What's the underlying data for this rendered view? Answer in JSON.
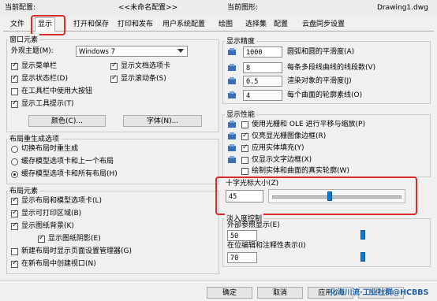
{
  "header": {
    "current_profile_label": "当前配置:",
    "current_profile_value": "<<未命名配置>>",
    "current_drawing_label": "当前图形:",
    "current_drawing_value": "Drawing1.dwg"
  },
  "tabs": [
    {
      "label": "文件"
    },
    {
      "label": "显示"
    },
    {
      "label": "打开和保存"
    },
    {
      "label": "打印和发布"
    },
    {
      "label": "用户系统配置"
    },
    {
      "label": "绘图"
    },
    {
      "label": "选择集"
    },
    {
      "label": "配置"
    },
    {
      "label": "云盘同步设置"
    }
  ],
  "window_elements": {
    "title": "窗口元素",
    "theme_label": "外观主题(M):",
    "theme_value": "Windows 7",
    "checks": [
      {
        "label": "显示菜单栏",
        "checked": true
      },
      {
        "label": "显示文档选项卡",
        "checked": true
      },
      {
        "label": "显示状态栏(D)",
        "checked": true
      },
      {
        "label": "显示滚动条(S)",
        "checked": true
      },
      {
        "label": "在工具栏中使用大按钮",
        "checked": false
      },
      {
        "label": "显示工具提示(T)",
        "checked": true
      }
    ],
    "color_button": "颜色(C)...",
    "font_button": "字体(N)..."
  },
  "layout_regen": {
    "title": "布局重生成选项",
    "options": [
      {
        "label": "切换布局时重生成",
        "selected": false
      },
      {
        "label": "缓存模型选项卡和上一个布局",
        "selected": false
      },
      {
        "label": "缓存模型选项卡和所有布局(H)",
        "selected": true
      }
    ]
  },
  "layout_elements": {
    "title": "布局元素",
    "checks": [
      {
        "label": "显示布局和模型选项卡(L)",
        "checked": true
      },
      {
        "label": "显示可打印区域(B)",
        "checked": true
      },
      {
        "label": "显示图纸背景(K)",
        "checked": true
      },
      {
        "label": "显示图纸阴影(E)",
        "checked": true
      },
      {
        "label": "新建布局时显示页面设置管理器(G)",
        "checked": false
      },
      {
        "label": "在新布局中创建视口(N)",
        "checked": true
      }
    ]
  },
  "display_resolution": {
    "title": "显示精度",
    "rows": [
      {
        "value": "1000",
        "label": "圆弧和圆的平滑度(A)"
      },
      {
        "value": "8",
        "label": "每条多段线曲线的线段数(V)"
      },
      {
        "value": "0.5",
        "label": "渲染对象的平滑度(J)"
      },
      {
        "value": "4",
        "label": "每个曲面的轮廓素线(O)"
      }
    ]
  },
  "display_performance": {
    "title": "显示性能",
    "checks": [
      {
        "label": "使用光栅和 OLE 进行平移与缩放(P)",
        "checked": false
      },
      {
        "label": "仅亮显光栅图像边框(R)",
        "checked": true
      },
      {
        "label": "应用实体填充(Y)",
        "checked": true
      },
      {
        "label": "仅显示文字边框(X)",
        "checked": false
      },
      {
        "label": "绘制实体和曲面的真实轮廓(W)",
        "checked": false
      }
    ]
  },
  "crosshair": {
    "title": "十字光标大小(Z)",
    "value": "45",
    "level_percent": 45
  },
  "fade_control": {
    "title": "淡入度控制",
    "xref_label": "外部参照显示(E)",
    "xref_value": "50",
    "xref_level_percent": 50,
    "inplace_label": "在位编辑和注释性表示(I)",
    "inplace_value": "70",
    "inplace_level_percent": 70
  },
  "footer": {
    "ok": "确定",
    "cancel": "取消",
    "apply": "应用(A)",
    "help": "帮助(H)"
  },
  "watermark": "化海川流·工业社群@HCBBS"
}
